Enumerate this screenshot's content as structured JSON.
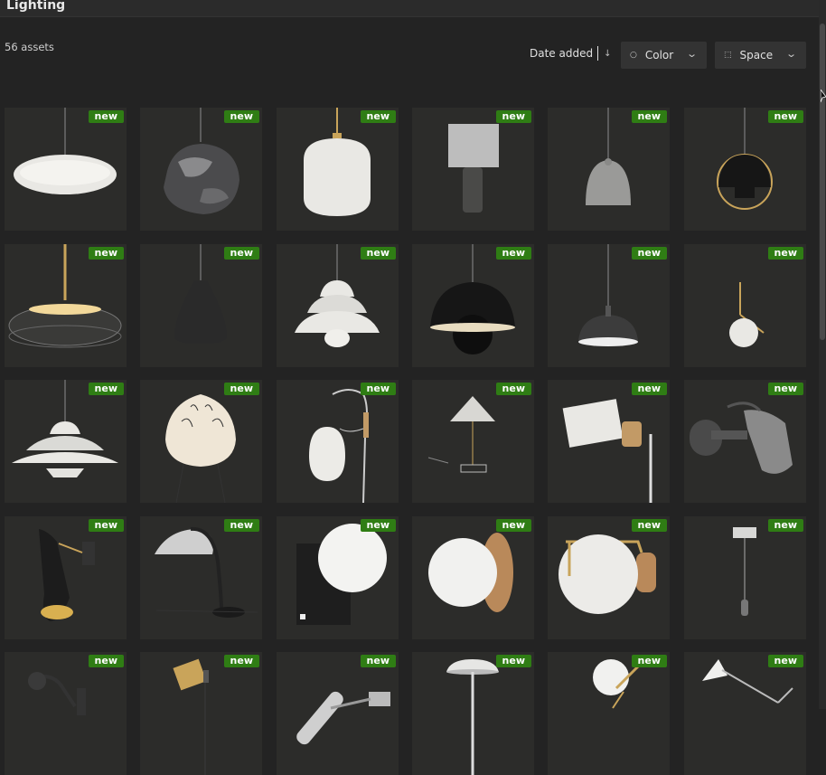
{
  "header": {
    "title": "Lighting"
  },
  "toolbar": {
    "asset_count": "56 assets",
    "sort_label": "Date added",
    "sort_direction_icon": "arrow-down-icon",
    "color_filter": {
      "label": "Color",
      "icon": "drop-icon"
    },
    "space_filter": {
      "label": "Space",
      "icon": "expand-icon"
    }
  },
  "grid": {
    "badge_label": "new",
    "badge_color": "#2f7d14",
    "items": [
      {
        "badge": "new",
        "type": "pendant-saucer"
      },
      {
        "badge": "new",
        "type": "pendant-smoked-glass"
      },
      {
        "badge": "new",
        "type": "pendant-opal-glass"
      },
      {
        "badge": "new",
        "type": "table-lamp-marble"
      },
      {
        "badge": "new",
        "type": "pendant-bell-grey"
      },
      {
        "badge": "new",
        "type": "pendant-multi-lite"
      },
      {
        "badge": "new",
        "type": "pendant-glass-disc"
      },
      {
        "badge": "new",
        "type": "pendant-beat-black"
      },
      {
        "badge": "new",
        "type": "pendant-tiered-white"
      },
      {
        "badge": "new",
        "type": "pendant-flowerpot-black"
      },
      {
        "badge": "new",
        "type": "pendant-dome-dark"
      },
      {
        "badge": "new",
        "type": "wall-sphere-brass"
      },
      {
        "badge": "new",
        "type": "pendant-ph5-white"
      },
      {
        "badge": "new",
        "type": "floor-paper-lamp"
      },
      {
        "badge": "new",
        "type": "wall-cocoon-lamp"
      },
      {
        "badge": "new",
        "type": "table-pleated-lamp"
      },
      {
        "badge": "new",
        "type": "wall-spot-white"
      },
      {
        "badge": "new",
        "type": "wall-spot-grey"
      },
      {
        "badge": "new",
        "type": "wall-beat-black"
      },
      {
        "badge": "new",
        "type": "floor-arc-dome"
      },
      {
        "badge": "new",
        "type": "wall-globe-box"
      },
      {
        "badge": "new",
        "type": "wall-globe-wood"
      },
      {
        "badge": "new",
        "type": "wall-globe-brass"
      },
      {
        "badge": "new",
        "type": "pendant-cylinder-mini"
      },
      {
        "badge": "new",
        "type": "wall-arm-lamp"
      },
      {
        "badge": "new",
        "type": "table-brass-spot"
      },
      {
        "badge": "new",
        "type": "wall-tube-spot"
      },
      {
        "badge": "new",
        "type": "floor-dome-white"
      },
      {
        "badge": "new",
        "type": "wall-sphere-arm"
      },
      {
        "badge": "new",
        "type": "table-arm-white"
      }
    ]
  }
}
